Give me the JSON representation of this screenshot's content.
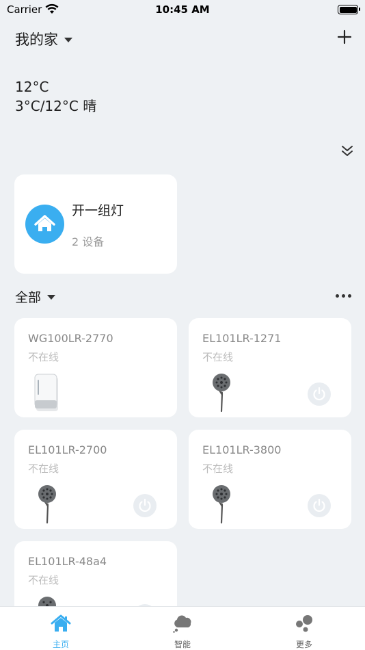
{
  "status_bar": {
    "carrier": "Carrier",
    "time": "10:45 AM"
  },
  "header": {
    "home_name": "我的家"
  },
  "weather": {
    "current": "12°C",
    "range": "3°C/12°C 晴"
  },
  "scene": {
    "name": "开一组灯",
    "device_count": "2 设备"
  },
  "devices_section": {
    "filter_label": "全部"
  },
  "devices": [
    {
      "name": "WG100LR-2770",
      "status": "不在线",
      "kind": "gateway"
    },
    {
      "name": "EL101LR-1271",
      "status": "不在线",
      "kind": "lamp"
    },
    {
      "name": "EL101LR-2700",
      "status": "不在线",
      "kind": "lamp"
    },
    {
      "name": "EL101LR-3800",
      "status": "不在线",
      "kind": "lamp"
    },
    {
      "name": "EL101LR-48a4",
      "status": "不在线",
      "kind": "lamp"
    }
  ],
  "tabs": [
    {
      "label": "主页",
      "icon": "home-icon",
      "active": true
    },
    {
      "label": "智能",
      "icon": "cloud-icon",
      "active": false
    },
    {
      "label": "更多",
      "icon": "bubbles-icon",
      "active": false
    }
  ],
  "colors": {
    "accent": "#3aaef0",
    "background": "#eef1f4",
    "card": "#ffffff"
  }
}
